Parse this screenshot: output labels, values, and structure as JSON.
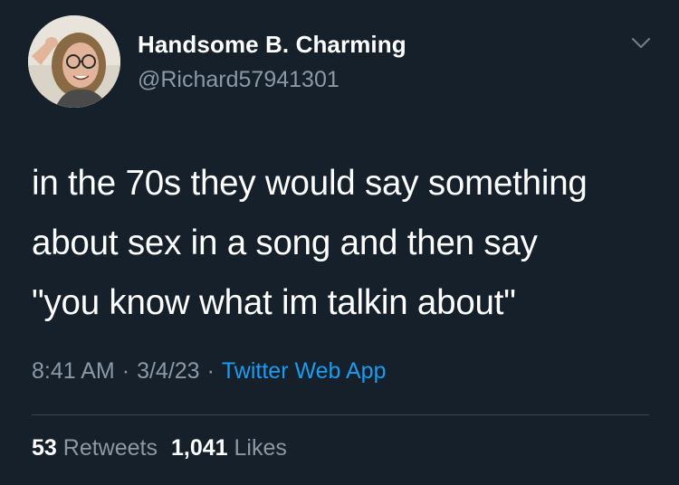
{
  "user": {
    "display_name": "Handsome B. Charming",
    "handle": "@Richard57941301",
    "avatar_icon": "profile-photo"
  },
  "tweet": {
    "text": "in the 70s they would say something\nabout sex in a song and then say\n\"you know what im talkin about\"",
    "time": "8:41 AM",
    "date": "3/4/23",
    "separator": "·",
    "source": "Twitter Web App"
  },
  "stats": {
    "retweets_count": "53",
    "retweets_label": "Retweets",
    "likes_count": "1,041",
    "likes_label": "Likes"
  },
  "menu": {
    "icon": "chevron-down-icon"
  },
  "colors": {
    "background": "#15202b",
    "text": "#ffffff",
    "secondary": "#8b98a5",
    "link": "#1d9bf0",
    "divider": "#38444d"
  }
}
